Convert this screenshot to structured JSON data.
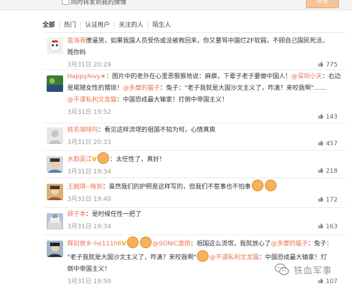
{
  "top": {
    "checkbox_label": "同时转发到我的微博",
    "post_button": "评论"
  },
  "tabs": [
    "全部",
    "热门",
    "认证用户",
    "关注的人",
    "陌生人"
  ],
  "comments": [
    {
      "user": "寇海哥",
      "sep": "：",
      "text": "傻逼货，如果我国人员受伤或没被救回来，你又要骂中国烂ZF软弱，不顾自己国民死活，",
      "text2": "贱你妈",
      "time": "3月31日 20:29",
      "likes": "775"
    },
    {
      "user": "HappyAivy",
      "text": "：图片中的老外在心里恶狠狠地说：麻痹，下辈子老子要做中国人！",
      "mention1": "@深圳小天",
      "text_b": "：右边",
      "line2": "是尾随女性的猥琐！",
      "mention2": "@多摩的猫子",
      "text_c": "：兔子：\"老子我就是大国沙文主义了，咋滴？来咬我啊\"……",
      "mention3": "@不谋私利文龙猫",
      "text_d": "：中国恐成最大输家！打倒中帝国主义！",
      "time": "3月31日 19:52",
      "likes": "143"
    },
    {
      "user": "姓名咖啡吗",
      "text": "：看见这样流氓的祖国不知为何，心情真爽",
      "time": "3月31日 20:33",
      "likes": "457"
    },
    {
      "user": "水韵吴江",
      "text": "：太任性了，真好！",
      "time": "3月31日 19:34",
      "likes": "218"
    },
    {
      "user": "王婉琪--拖到",
      "text": "：虽然我们的护照是这样写的，但我们不惹事也不怕事",
      "time": "3月31日 19:40",
      "likes": "172"
    },
    {
      "user": "顾子本",
      "text": "：是时候任性一把了",
      "time": "3月31日 19:34",
      "likes": "163"
    },
    {
      "user": "辉旧故乡-he111h6",
      "mention1": "@SONIC激扬",
      "text": "：祖国这么流氓，我就放心了",
      "mention2": "@多摩的猫子",
      "text_b": "：兔子：",
      "line2": "\"老子我就是大国沙文主义了，咋滴？来咬我啊\"",
      "mention3": "@不谋私利文龙猫",
      "text_c": "：中国恐成最大输家！打",
      "line3": "倒中帝国主义！",
      "time": "3月31日 19:50",
      "likes": "107"
    }
  ],
  "watermark": "铁血军事"
}
